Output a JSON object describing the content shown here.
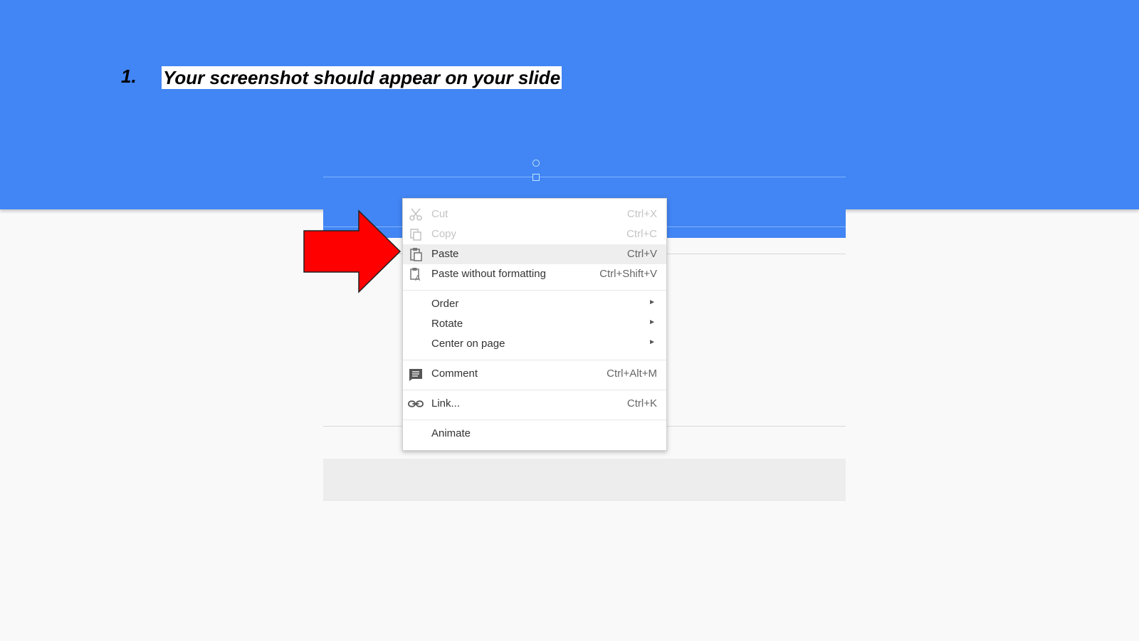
{
  "slide": {
    "step_number": "1.",
    "instruction": "Your screenshot should appear on your slide"
  },
  "arrow": {
    "color": "#ff0000",
    "icon": "right-arrow-icon"
  },
  "colors": {
    "band": "#4285f4",
    "background": "#f9f9f9",
    "menu_hover": "#eeeeee"
  },
  "context_menu": {
    "items": [
      {
        "label": "Cut",
        "shortcut": "Ctrl+X",
        "icon": "scissors-icon",
        "disabled": true
      },
      {
        "label": "Copy",
        "shortcut": "Ctrl+C",
        "icon": "copy-icon",
        "disabled": true
      },
      {
        "label": "Paste",
        "shortcut": "Ctrl+V",
        "icon": "paste-icon",
        "highlighted": true
      },
      {
        "label": "Paste without formatting",
        "shortcut": "Ctrl+Shift+V",
        "icon": "paste-plain-icon"
      },
      {
        "label": "Order",
        "submenu": true
      },
      {
        "label": "Rotate",
        "submenu": true
      },
      {
        "label": "Center on page",
        "submenu": true
      },
      {
        "label": "Comment",
        "shortcut": "Ctrl+Alt+M",
        "icon": "comment-icon"
      },
      {
        "label": "Link...",
        "shortcut": "Ctrl+K",
        "icon": "link-icon"
      },
      {
        "label": "Animate"
      }
    ]
  }
}
